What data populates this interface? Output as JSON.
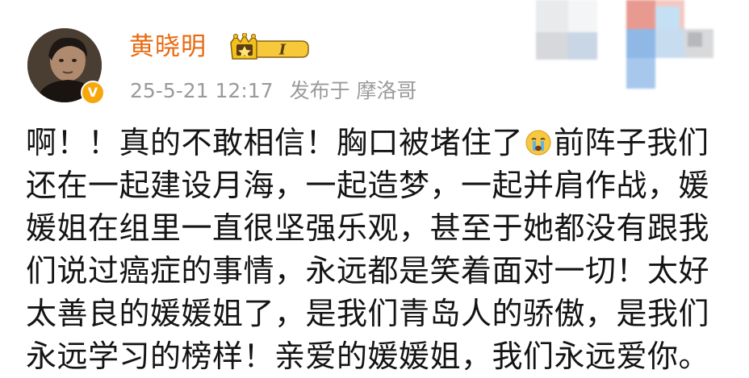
{
  "author": {
    "name": "黄晓明",
    "verified_mark": "V",
    "vip_level": "I",
    "avatar_icon": "avatar-photo"
  },
  "post_meta": {
    "date_time": "25-5-21 12:17",
    "location": "发布于 摩洛哥"
  },
  "post": {
    "lines": [
      "啊！！真的不敢相信！胸口被堵住了",
      "前阵子我们",
      "还在一起建设月海，一起造梦，一起并肩作战，媛",
      "媛姐在组里一直很坚强乐观，甚至于她都没有跟我",
      "们说过癌症的事情，永远都是笑着面对一切！太好",
      "太善良的媛媛姐了，是我们青岛人的骄傲，是我们",
      "永远学习的榜样！亲爱的媛媛姐，我们永远爱你。"
    ],
    "emoji": "crying-face-emoji"
  },
  "colors": {
    "username": "#e86a10",
    "meta": "#9a9a9a",
    "text": "#141414",
    "verified": "#f7a70a"
  }
}
